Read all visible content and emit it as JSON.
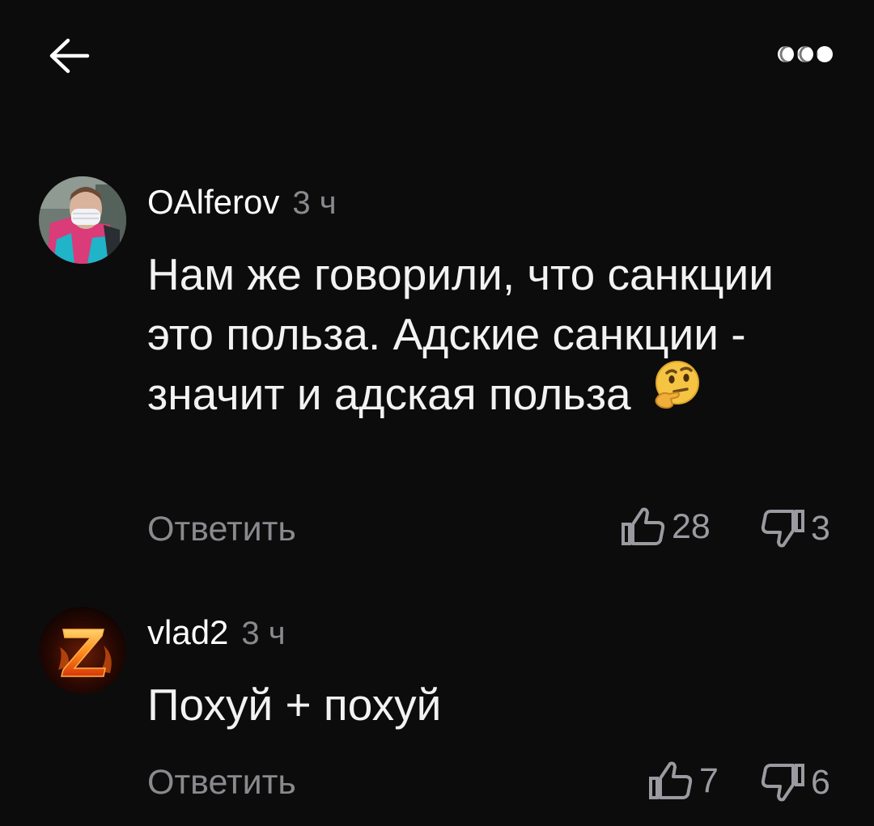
{
  "header": {
    "back_icon": "arrow-left-icon",
    "more_icon": "more-dots-icon"
  },
  "comments": [
    {
      "author": "OAlferov",
      "time": "3 ч",
      "text": "Нам же говорили, что санкции это польза. Адские санкции - значит и адская польза",
      "emoji": "thinking-face",
      "reply_label": "Ответить",
      "likes": "28",
      "dislikes": "3"
    },
    {
      "author": "vlad2",
      "time": "3 ч",
      "text": "Похуй + похуй",
      "reply_label": "Ответить",
      "likes": "7",
      "dislikes": "6"
    }
  ],
  "colors": {
    "background": "#0c0c0d",
    "text_primary": "#ffffff",
    "text_secondary": "#8a8a8e"
  }
}
